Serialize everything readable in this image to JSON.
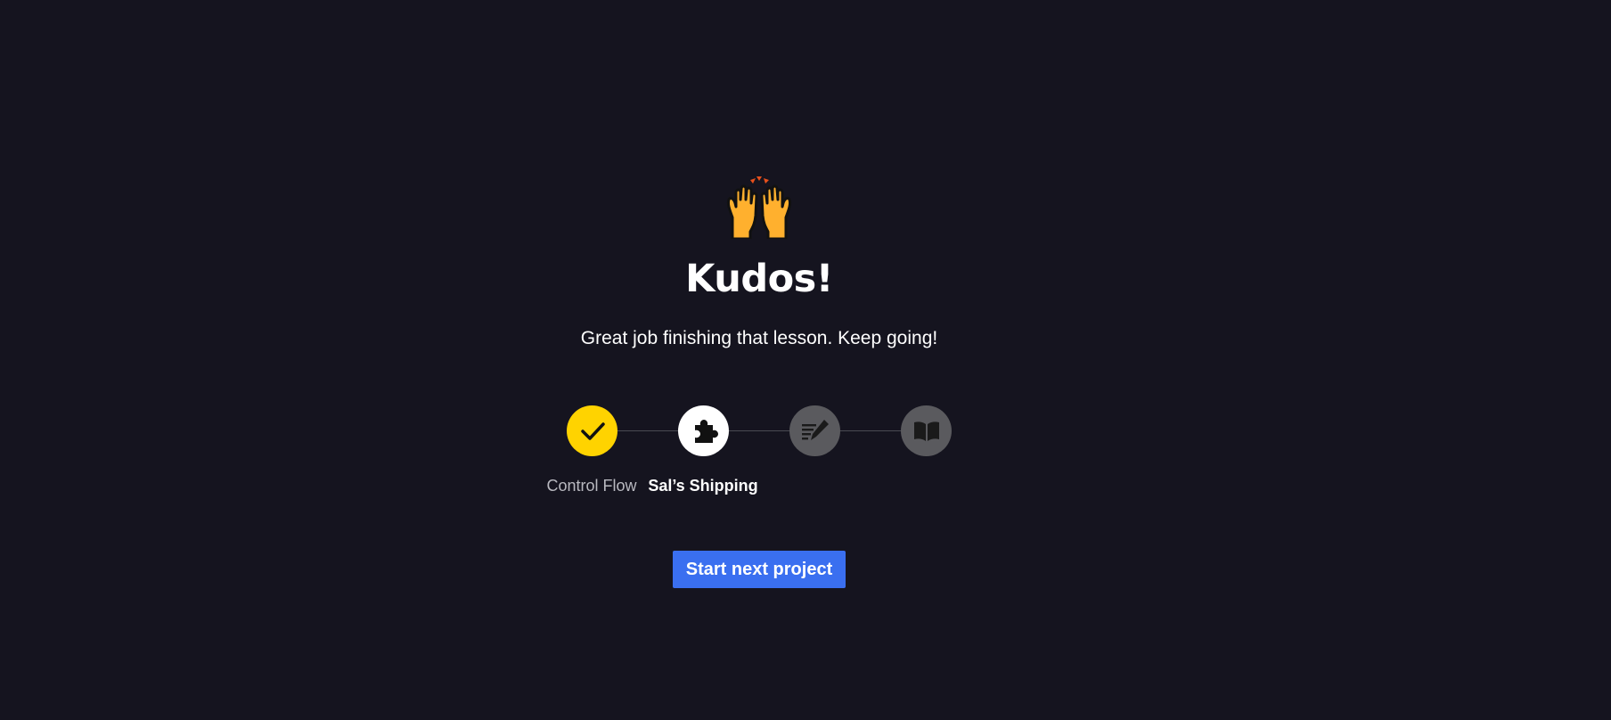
{
  "celebration": {
    "emoji_icon": "raising-hands-icon",
    "title": "Kudos!",
    "subtitle": "Great job finishing that lesson. Keep going!"
  },
  "steps": [
    {
      "label": "Control Flow",
      "status": "completed",
      "icon": "checkmark-icon",
      "color": "#ffd300"
    },
    {
      "label": "Sal’s Shipping",
      "status": "current",
      "icon": "puzzle-piece-icon",
      "color": "#ffffff"
    },
    {
      "label": "",
      "status": "locked",
      "icon": "quiz-pencil-icon",
      "color": "#5a5a5e"
    },
    {
      "label": "",
      "status": "locked",
      "icon": "open-book-icon",
      "color": "#5a5a5e"
    }
  ],
  "actions": {
    "next_label": "Start next project"
  },
  "colors": {
    "background": "#15141f",
    "accent": "#3a6ff0",
    "completed": "#ffd300"
  }
}
